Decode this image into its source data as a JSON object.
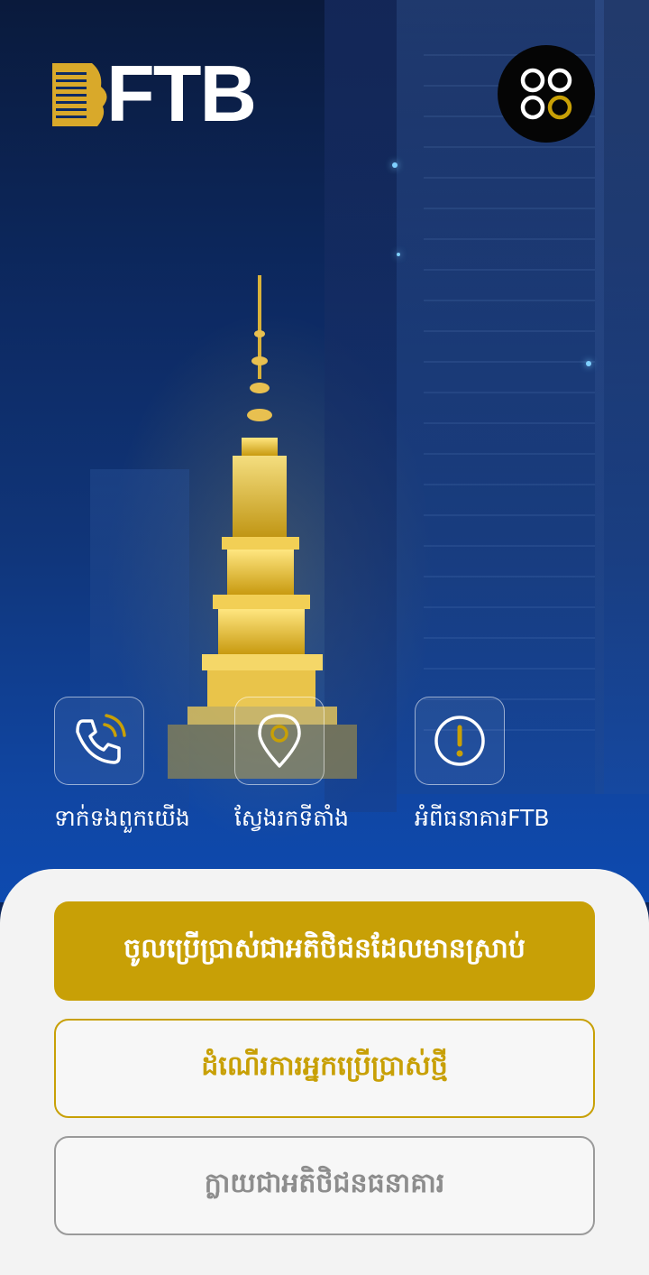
{
  "brand": {
    "name": "FTB"
  },
  "header": {
    "menu_icon": "apps-grid-icon"
  },
  "quick_actions": [
    {
      "label": "ទាក់ទងពួកយើង",
      "icon": "phone-call-icon"
    },
    {
      "label": "ស្វែងរកទីតាំង",
      "icon": "map-pin-icon"
    },
    {
      "label": "អំពីធនាគារFTB",
      "icon": "info-alert-icon"
    }
  ],
  "actions": {
    "login_existing": "ចូលប្រើប្រាស់ជាអតិថិជនដែលមានស្រាប់",
    "new_user": "ដំណើរការអ្នកប្រើប្រាស់ថ្មី",
    "become_customer": "ក្លាយជាអតិថិជនធនាគារ"
  },
  "colors": {
    "gold": "#c8a006",
    "navy": "#0d2a63",
    "sheet": "#f3f3f3"
  }
}
